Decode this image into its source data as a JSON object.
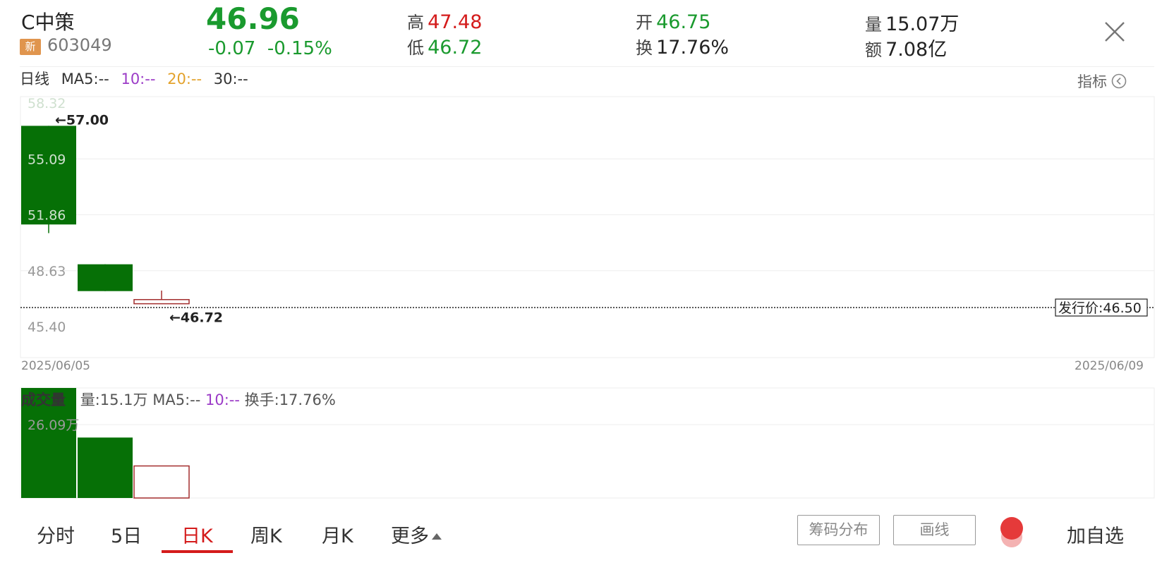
{
  "stock": {
    "name": "C中策",
    "badge": "新",
    "code": "603049",
    "price": "46.96",
    "change": "-0.07",
    "change_pct": "-0.15%"
  },
  "quote": {
    "high_label": "高",
    "high": "47.48",
    "low_label": "低",
    "low": "46.72",
    "open_label": "开",
    "open": "46.75",
    "turnover_label": "换",
    "turnover": "17.76%",
    "volume_label": "量",
    "volume": "15.07万",
    "amount_label": "额",
    "amount": "7.08亿"
  },
  "ma_row": {
    "period": "日线",
    "ma5": "MA5:--",
    "ma10": "10:--",
    "ma20": "20:--",
    "ma30": "30:--",
    "indicator": "指标"
  },
  "price_axis": [
    "58.32",
    "55.09",
    "51.86",
    "48.63",
    "45.40"
  ],
  "annotations": {
    "max": "←57.00",
    "min": "←46.72",
    "issue_price": "发行价:46.50"
  },
  "dates": {
    "start": "2025/06/05",
    "end": "2025/06/09"
  },
  "chart_data": {
    "type": "candlestick",
    "y_range": [
      45.4,
      58.32
    ],
    "y_ticks": [
      58.32,
      55.09,
      51.86,
      48.63,
      45.4
    ],
    "issue_price": 46.5,
    "candles": [
      {
        "open": 57.0,
        "close": 51.3,
        "high": 57.0,
        "low": 50.8,
        "color": "#067006"
      },
      {
        "open": 49.0,
        "close": 47.45,
        "high": 49.0,
        "low": 47.45,
        "color": "#067006"
      },
      {
        "open": 46.72,
        "close": 46.96,
        "high": 47.48,
        "low": 46.72,
        "color": "#a32d2d"
      }
    ],
    "volume": {
      "y_max": 39.14,
      "tick": "26.09万",
      "tick_value": 26.09,
      "bars": [
        {
          "value": 39.14,
          "color": "#067006",
          "filled": true
        },
        {
          "value": 21.5,
          "color": "#067006",
          "filled": true
        },
        {
          "value": 11.4,
          "color": "#a32d2d",
          "filled": false
        }
      ]
    }
  },
  "volume_panel": {
    "title": "成交量",
    "vol": "量:15.1万",
    "ma5": "MA5:--",
    "ma10": "10:--",
    "turnover": "换手:17.76%"
  },
  "tabs": {
    "fenshi": "分时",
    "day5": "5日",
    "dayk": "日K",
    "weekk": "周K",
    "monthk": "月K",
    "more": "更多"
  },
  "actions": {
    "chip": "筹码分布",
    "draw": "画线",
    "add_fav": "加自选"
  }
}
